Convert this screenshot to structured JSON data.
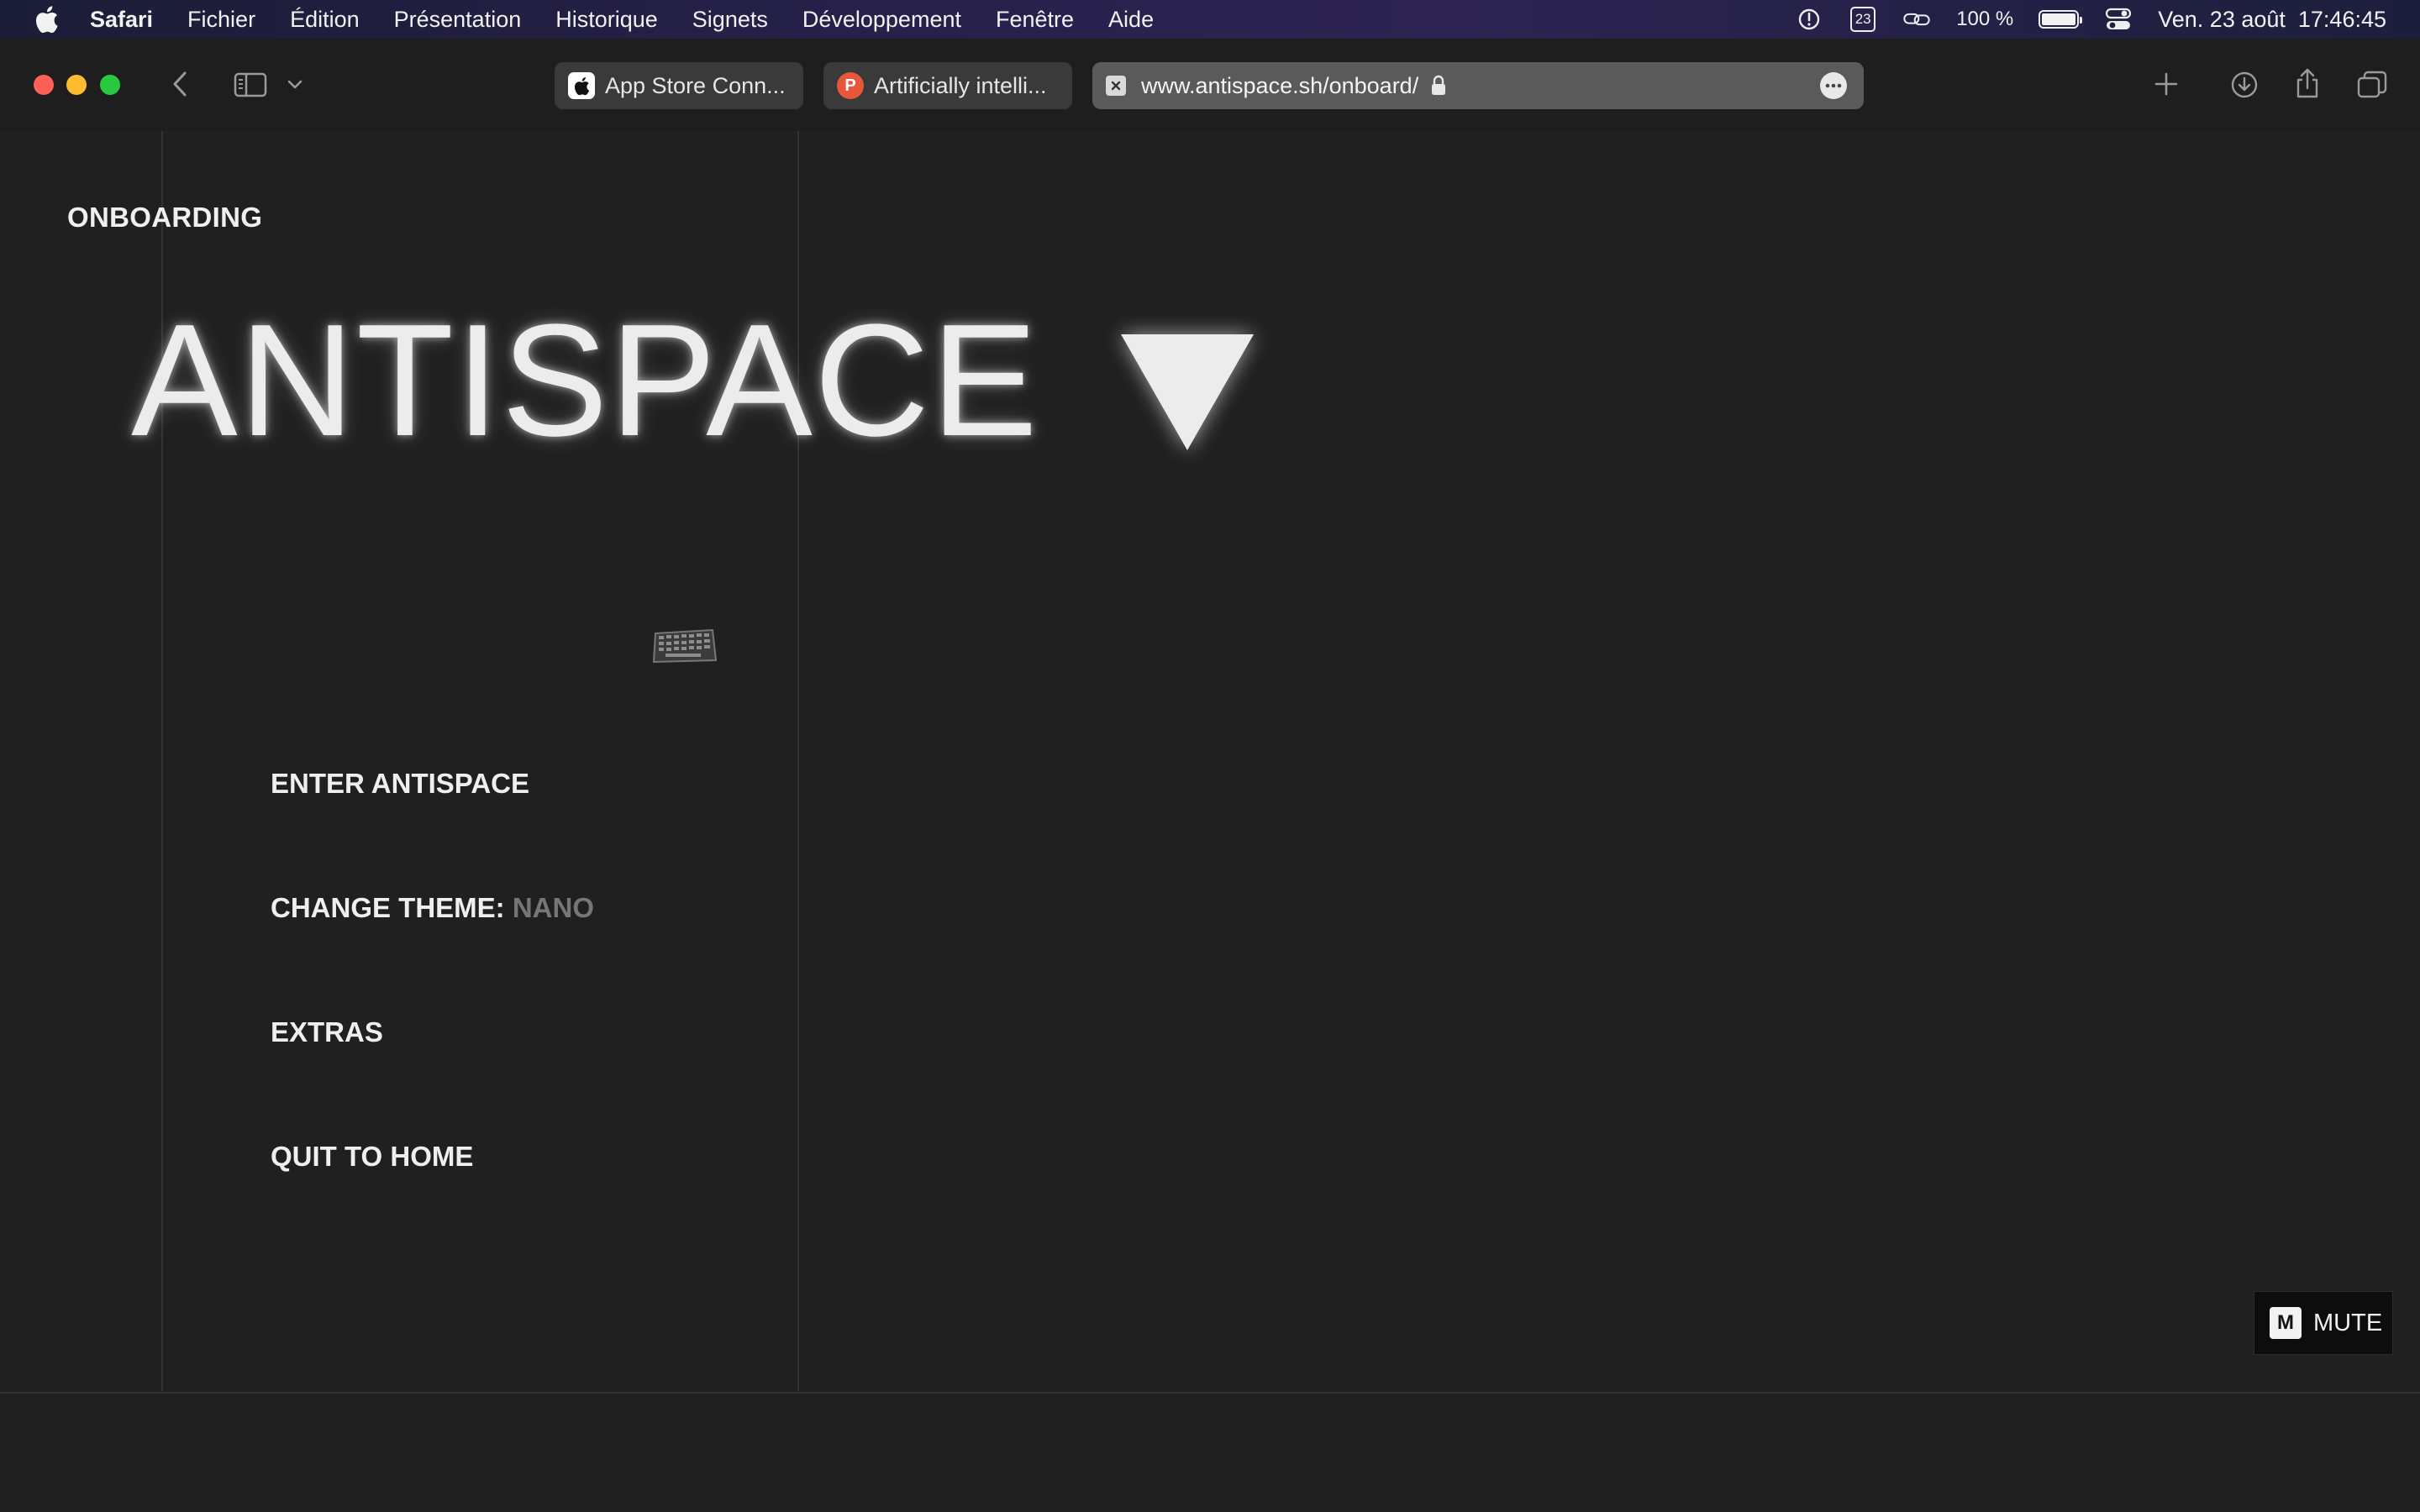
{
  "menubar": {
    "app_name": "Safari",
    "menus": [
      "Fichier",
      "Édition",
      "Présentation",
      "Historique",
      "Signets",
      "Développement",
      "Fenêtre",
      "Aide"
    ],
    "calendar_day": "23",
    "battery_percent": "100 %",
    "battery_level": 1.0,
    "datetime": "Ven. 23 août  17:46:45"
  },
  "browser": {
    "tabs": [
      {
        "title": "App Store Conn...",
        "icon": "apple-icon"
      },
      {
        "title": "Artificially intelli...",
        "icon": "producthunt-icon",
        "favicon_letter": "P",
        "favicon_color": "#e8573b"
      }
    ],
    "address": "www.antispace.sh/onboard/"
  },
  "page": {
    "section_label": "ONBOARDING",
    "logo_text": "ANTISPACE",
    "menu": {
      "enter": "ENTER ANTISPACE",
      "theme_label": "CHANGE THEME:",
      "theme_value": "NANO",
      "extras": "EXTRAS",
      "quit": "QUIT TO HOME"
    },
    "mute_key": "M",
    "mute_label": "MUTE"
  },
  "colors": {
    "background": "#202020",
    "text": "#ececec",
    "muted_text": "#767676",
    "divider": "#333333"
  }
}
